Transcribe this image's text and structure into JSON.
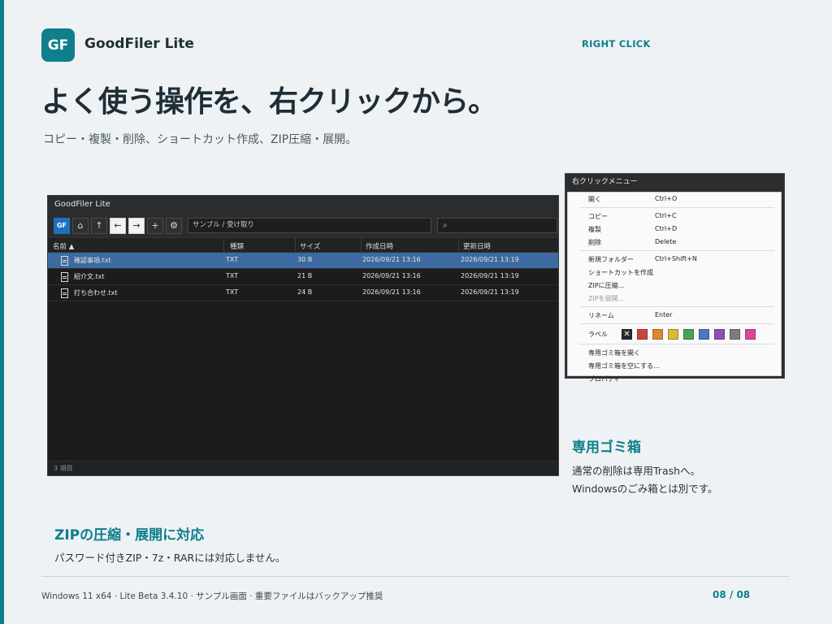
{
  "brand": {
    "logo_text": "GF",
    "app_name": "GoodFiler Lite",
    "accent": "#0e7f8b"
  },
  "section_tag": "RIGHT CLICK",
  "headline": "よく使う操作を、右クリックから。",
  "subhead": "コピー・複製・削除、ショートカット作成、ZIP圧縮・展開。",
  "window": {
    "title": "GoodFiler Lite",
    "toolbar": {
      "logo_btn": "GF",
      "home_icon": "⌂",
      "up_icon": "↑",
      "back_icon": "←",
      "forward_icon": "→",
      "add_icon": "+",
      "settings_icon": "⚙",
      "path": "サンプル / 受け取り",
      "search_icon": "⌕"
    },
    "columns": [
      "名前 ▲",
      "種類",
      "サイズ",
      "作成日時",
      "更新日時"
    ],
    "rows": [
      {
        "name": "確認事項.txt",
        "type": "TXT",
        "size": "30 B",
        "created": "2026/09/21 13:16",
        "modified": "2026/09/21 13:19",
        "selected": true
      },
      {
        "name": "紹介文.txt",
        "type": "TXT",
        "size": "21 B",
        "created": "2026/09/21 13:16",
        "modified": "2026/09/21 13:19",
        "selected": false
      },
      {
        "name": "打ち合わせ.txt",
        "type": "TXT",
        "size": "24 B",
        "created": "2026/09/21 13:16",
        "modified": "2026/09/21 13:19",
        "selected": false
      }
    ],
    "status": "3 項目"
  },
  "context_menu": {
    "title": "右クリックメニュー",
    "items": [
      {
        "label": "開く",
        "shortcut": "Ctrl+O"
      },
      {
        "label": "コピー",
        "shortcut": "Ctrl+C"
      },
      {
        "label": "複製",
        "shortcut": "Ctrl+D"
      },
      {
        "label": "削除",
        "shortcut": "Delete"
      },
      {
        "label": "新規フォルダー",
        "shortcut": "Ctrl+Shift+N"
      },
      {
        "label": "ショートカットを作成",
        "shortcut": ""
      },
      {
        "label": "ZIPに圧縮...",
        "shortcut": ""
      },
      {
        "label": "ZIPを展開...",
        "shortcut": "",
        "disabled": true
      },
      {
        "label": "リネーム",
        "shortcut": "Enter"
      },
      {
        "label": "専用ゴミ箱を開く",
        "shortcut": ""
      },
      {
        "label": "専用ゴミ箱を空にする...",
        "shortcut": ""
      },
      {
        "label": "プロパティ",
        "shortcut": ""
      }
    ],
    "label_row": {
      "label": "ラベル",
      "clear_symbol": "✕",
      "colors": [
        "#c8453f",
        "#d98a32",
        "#d9b93a",
        "#4aa05a",
        "#4a78c8",
        "#8a52b8",
        "#7c7c7c",
        "#d8479a"
      ]
    }
  },
  "callouts": {
    "trash": {
      "title": "専用ゴミ箱",
      "line1": "通常の削除は専用Trashへ。",
      "line2": "Windowsのごみ箱とは別です。"
    },
    "zip": {
      "title": "ZIPの圧縮・展開に対応",
      "text": "パスワード付きZIP・7z・RARには対応しません。"
    }
  },
  "footer": {
    "note": "Windows 11 x64 · Lite Beta 3.4.10 · サンプル画面 · 重要ファイルはバックアップ推奨",
    "page": "08 / 08"
  }
}
